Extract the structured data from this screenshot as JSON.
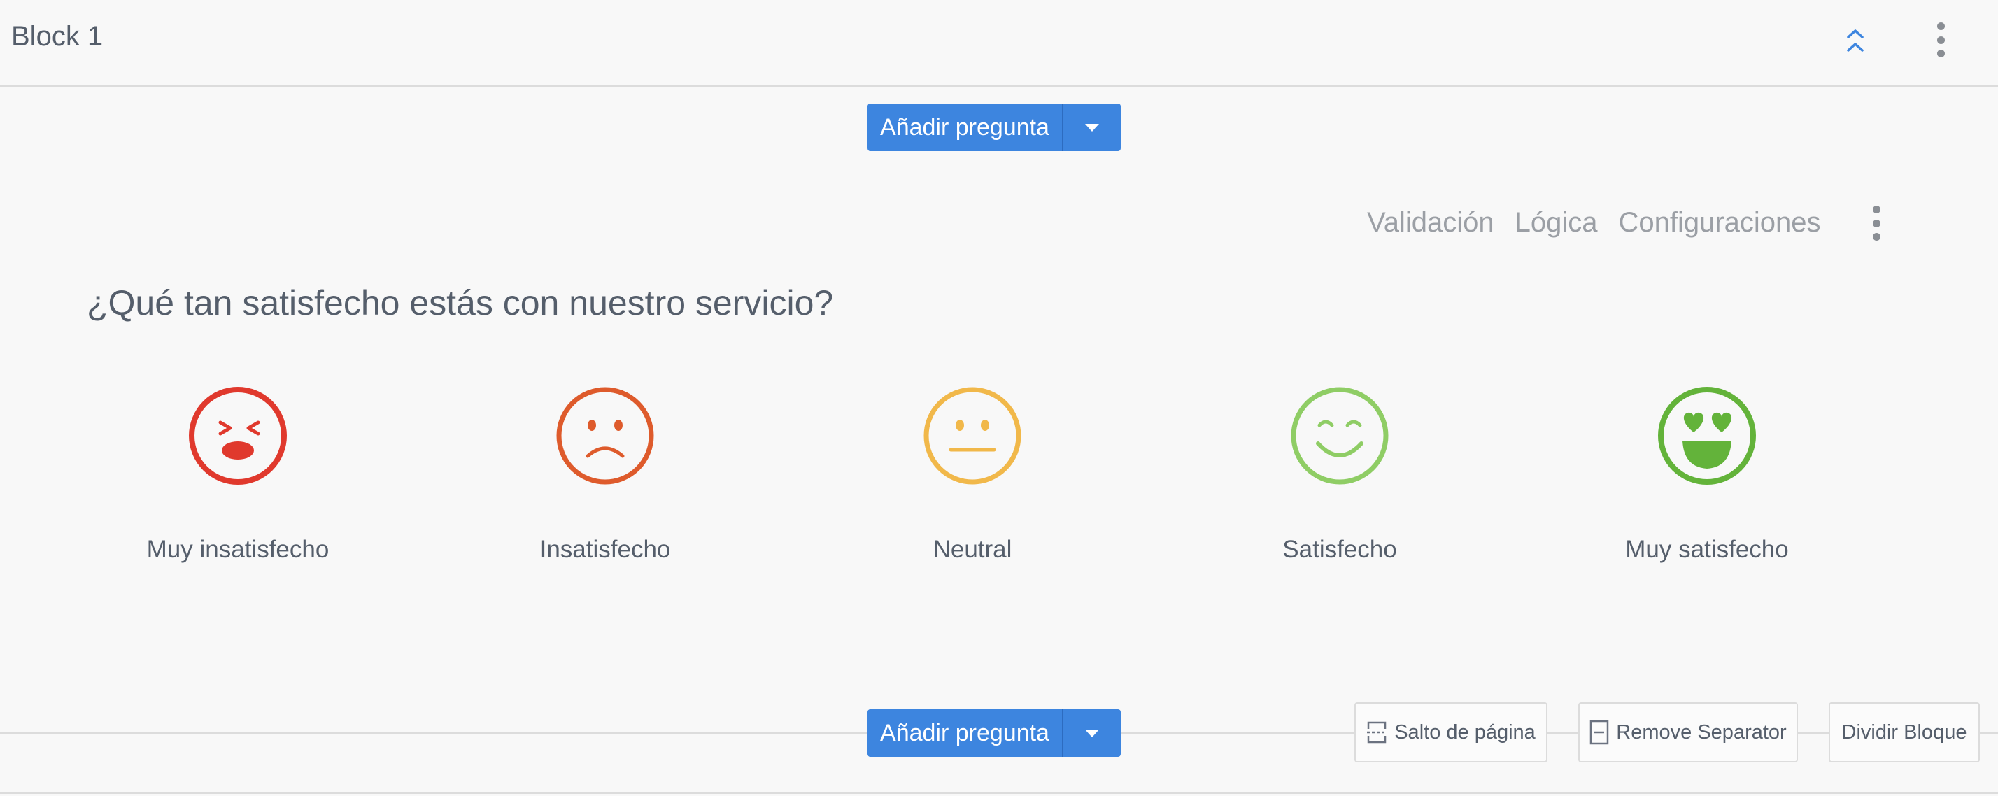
{
  "block": {
    "title": "Block 1"
  },
  "add_question": {
    "label": "Añadir pregunta"
  },
  "question_toolbar": {
    "validation": "Validación",
    "logic": "Lógica",
    "settings": "Configuraciones"
  },
  "question": {
    "text": "¿Qué tan satisfecho estás con nuestro servicio?",
    "options": [
      {
        "label": "Muy insatisfecho",
        "icon": "very-dissatisfied-face-icon",
        "color": "#e0392d"
      },
      {
        "label": "Insatisfecho",
        "icon": "dissatisfied-face-icon",
        "color": "#de5b2c"
      },
      {
        "label": "Neutral",
        "icon": "neutral-face-icon",
        "color": "#f1b84a"
      },
      {
        "label": "Satisfecho",
        "icon": "satisfied-face-icon",
        "color": "#8fcd65"
      },
      {
        "label": "Muy satisfecho",
        "icon": "very-satisfied-face-icon",
        "color": "#63b33a"
      }
    ]
  },
  "separator_actions": {
    "page_break": "Salto de página",
    "remove_separator": "Remove Separator",
    "split_block": "Dividir Bloque"
  },
  "colors": {
    "accent": "#3d85df",
    "text": "#555e6b",
    "muted": "#9b9fa5"
  }
}
